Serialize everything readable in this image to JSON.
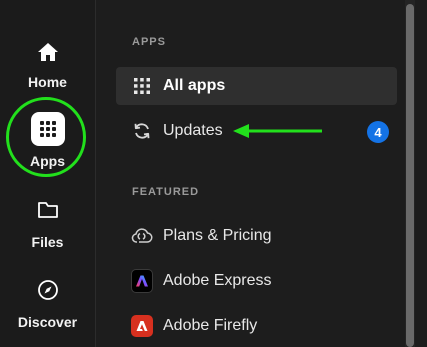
{
  "rail": {
    "items": [
      {
        "label": "Home",
        "icon": "home-icon"
      },
      {
        "label": "Apps",
        "icon": "apps-grid-icon"
      },
      {
        "label": "Files",
        "icon": "folder-icon"
      },
      {
        "label": "Discover",
        "icon": "compass-icon"
      }
    ]
  },
  "panel": {
    "apps_header": "APPS",
    "featured_header": "FEATURED",
    "items": [
      {
        "label": "All apps",
        "icon": "grid-icon"
      },
      {
        "label": "Updates",
        "icon": "refresh-icon",
        "badge": "4"
      },
      {
        "label": "Plans & Pricing",
        "icon": "creative-cloud-icon"
      },
      {
        "label": "Adobe Express",
        "icon": "adobe-express-icon"
      },
      {
        "label": "Adobe Firefly",
        "icon": "adobe-firefly-icon"
      }
    ]
  },
  "colors": {
    "background": "#1d1d1d",
    "highlight_circle": "#22e01c",
    "arrow": "#22e01c",
    "badge": "#1473e6",
    "active_item": "#2f2f2f",
    "firefly_logo": "#d7301f"
  }
}
